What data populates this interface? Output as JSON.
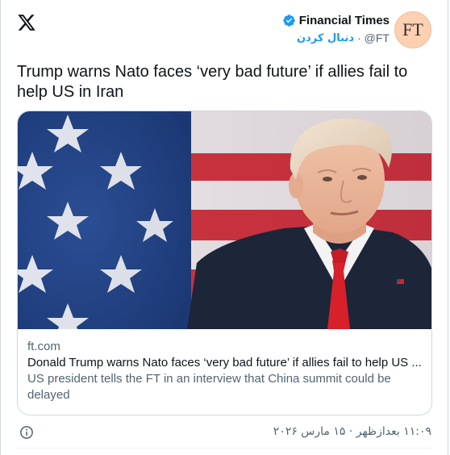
{
  "author": {
    "display_name": "Financial Times",
    "handle": "@FT",
    "separator": "·",
    "follow_label": "دنبال کردن",
    "avatar_text": "FT",
    "verified_color": "#1d9bf0",
    "avatar_bg": "#fcd0b1"
  },
  "tweet": {
    "text": "Trump warns Nato faces ‘very bad future’ if allies fail to help US in Iran"
  },
  "card": {
    "domain": "ft.com",
    "title": "Donald Trump warns Nato faces ‘very bad future’ if allies fail to help US ...",
    "description": "US president tells the FT in an interview that China summit could be delayed"
  },
  "footer": {
    "timestamp": "۱۱:۰۹ بعدازظهر · ۱۵ مارس ۲۰۲۶"
  },
  "icons": {
    "brand": "x-logo-icon",
    "verified": "verified-badge-icon",
    "info": "info-icon"
  }
}
